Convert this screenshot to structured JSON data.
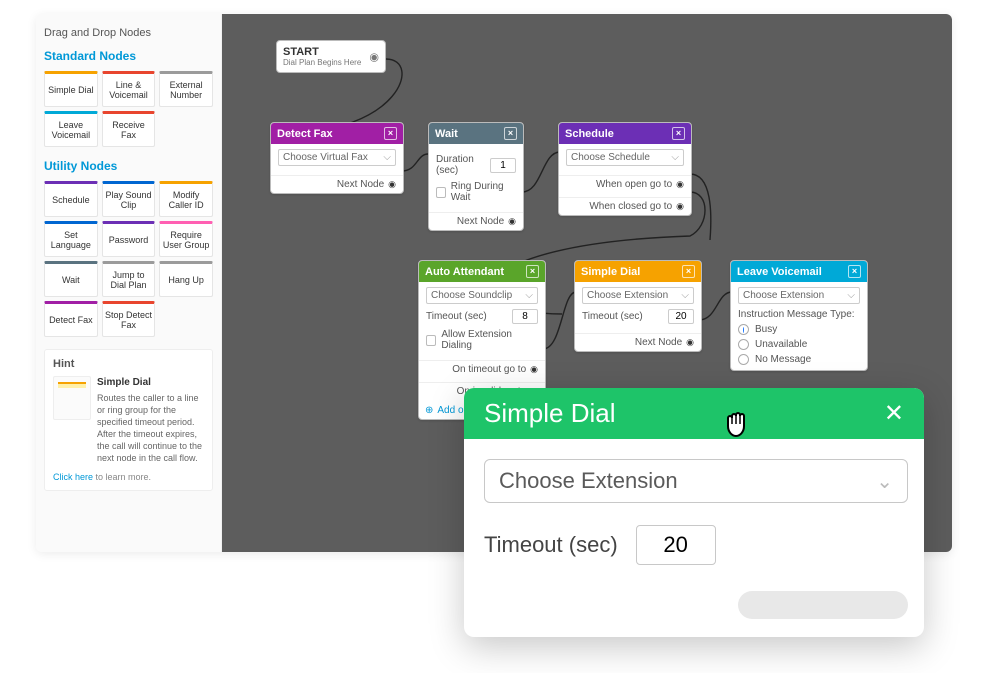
{
  "sidebar": {
    "title": "Drag and Drop Nodes",
    "sections": [
      {
        "heading": "Standard Nodes",
        "items": [
          {
            "label": "Simple Dial",
            "color": "#f6a200"
          },
          {
            "label": "Line & Voicemail",
            "color": "#e8452e"
          },
          {
            "label": "External Number",
            "color": "#9b9b9b"
          },
          {
            "label": "Leave Voicemail",
            "color": "#00a9d7"
          },
          {
            "label": "Receive Fax",
            "color": "#e8452e"
          }
        ]
      },
      {
        "heading": "Utility Nodes",
        "items": [
          {
            "label": "Schedule",
            "color": "#6c2fb5"
          },
          {
            "label": "Play Sound Clip",
            "color": "#0066d1"
          },
          {
            "label": "Modify Caller ID",
            "color": "#f6a200"
          },
          {
            "label": "Set Language",
            "color": "#0066d1"
          },
          {
            "label": "Password",
            "color": "#6c2fb5"
          },
          {
            "label": "Require User Group",
            "color": "#ff5fb2"
          },
          {
            "label": "Wait",
            "color": "#5a7380"
          },
          {
            "label": "Jump to Dial Plan",
            "color": "#9b9b9b"
          },
          {
            "label": "Hang Up",
            "color": "#9b9b9b"
          },
          {
            "label": "Detect Fax",
            "color": "#a11fa5"
          },
          {
            "label": "Stop Detect Fax",
            "color": "#e8452e"
          }
        ]
      }
    ],
    "hint": {
      "title": "Hint",
      "name": "Simple Dial",
      "text": "Routes the caller to a line or ring group for the specified timeout period. After the timeout expires, the call will continue to the next node in the call flow.",
      "link_prefix": "Click here",
      "link_suffix": " to learn more."
    }
  },
  "canvas": {
    "start": {
      "title": "START",
      "subtitle": "Dial Plan Begins Here"
    },
    "detect_fax": {
      "title": "Detect Fax",
      "select": "Choose Virtual Fax",
      "port": "Next Node",
      "color": "#a11fa5"
    },
    "wait": {
      "title": "Wait",
      "duration_label": "Duration (sec)",
      "duration_value": "1",
      "ring_label": "Ring During Wait",
      "port": "Next Node",
      "color": "#5a7380"
    },
    "schedule": {
      "title": "Schedule",
      "select": "Choose Schedule",
      "open": "When open go to",
      "closed": "When closed go to",
      "color": "#6c2fb5"
    },
    "auto_attendant": {
      "title": "Auto Attendant",
      "select": "Choose Soundclip",
      "timeout_label": "Timeout (sec)",
      "timeout_value": "8",
      "allow_label": "Allow Extension Dialing",
      "on_timeout": "On timeout go to",
      "on_invalid": "On invalid go to",
      "add_option": "Add option",
      "color": "#5aa52a"
    },
    "simple_dial": {
      "title": "Simple Dial",
      "select": "Choose Extension",
      "timeout_label": "Timeout (sec)",
      "timeout_value": "20",
      "port": "Next Node",
      "color": "#f6a200"
    },
    "leave_vm": {
      "title": "Leave Voicemail",
      "select": "Choose Extension",
      "msg_label": "Instruction Message Type:",
      "opts": [
        "Busy",
        "Unavailable",
        "No Message"
      ],
      "selected": 0,
      "color": "#00a9d7"
    }
  },
  "popup": {
    "title": "Simple Dial",
    "select": "Choose Extension",
    "timeout_label": "Timeout (sec)",
    "timeout_value": "20"
  }
}
